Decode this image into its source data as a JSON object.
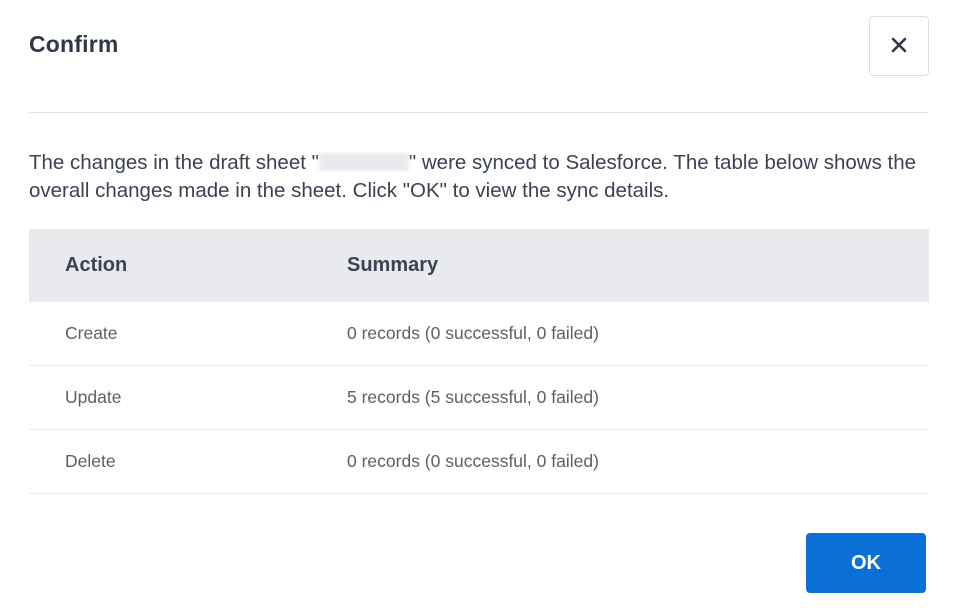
{
  "dialog": {
    "title": "Confirm",
    "message_part1": "The changes in the draft sheet \"",
    "message_part2": "\" were synced to Salesforce. The table below shows the overall changes made in the sheet. Click \"OK\" to view the sync details.",
    "ok_label": "OK",
    "close_icon": "close-icon"
  },
  "table": {
    "headers": {
      "action": "Action",
      "summary": "Summary"
    },
    "rows": [
      {
        "action": "Create",
        "summary": "0 records (0 successful, 0 failed)"
      },
      {
        "action": "Update",
        "summary": "5 records (5 successful, 0 failed)"
      },
      {
        "action": "Delete",
        "summary": "0 records (0 successful, 0 failed)"
      }
    ]
  },
  "colors": {
    "primary": "#0a6fd6",
    "header_bg": "#e9eaee"
  }
}
